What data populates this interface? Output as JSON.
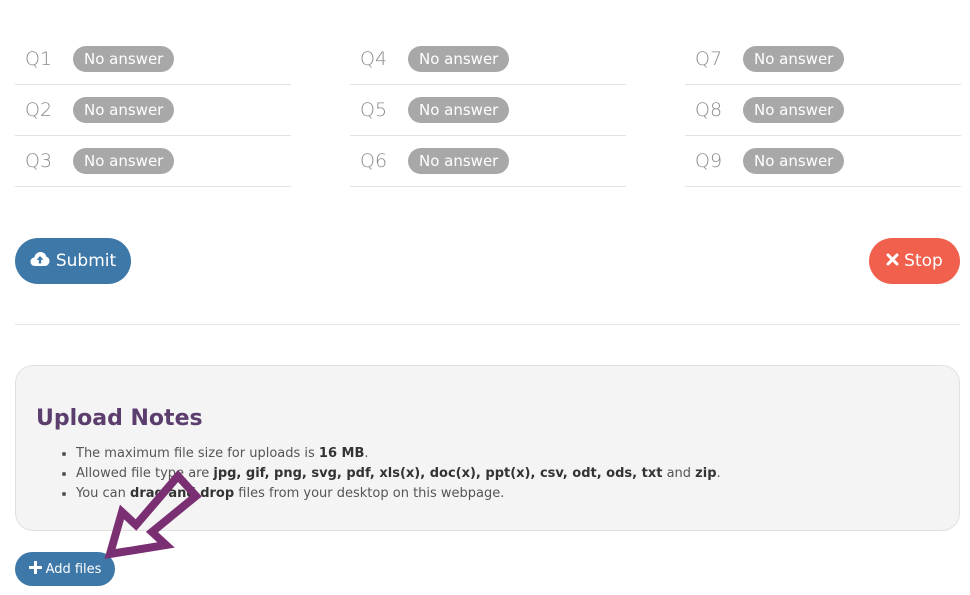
{
  "questions": {
    "col1": [
      {
        "label": "Q1",
        "status": "No answer"
      },
      {
        "label": "Q2",
        "status": "No answer"
      },
      {
        "label": "Q3",
        "status": "No answer"
      }
    ],
    "col2": [
      {
        "label": "Q4",
        "status": "No answer"
      },
      {
        "label": "Q5",
        "status": "No answer"
      },
      {
        "label": "Q6",
        "status": "No answer"
      }
    ],
    "col3": [
      {
        "label": "Q7",
        "status": "No answer"
      },
      {
        "label": "Q8",
        "status": "No answer"
      },
      {
        "label": "Q9",
        "status": "No answer"
      }
    ]
  },
  "actions": {
    "submit_label": "Submit",
    "stop_label": "Stop",
    "submit_color": "#3d78a8",
    "stop_color": "#f0604d"
  },
  "upload_notes": {
    "title": "Upload Notes",
    "note1_prefix": "The maximum file size for uploads is ",
    "note1_size": "16 MB",
    "note1_suffix": ".",
    "note2_prefix": "Allowed file type are ",
    "note2_types": "jpg, gif, png, svg, pdf, xls(x), doc(x), ppt(x), csv, odt, ods, txt",
    "note2_and": " and ",
    "note2_last": "zip",
    "note2_suffix": ".",
    "note3_prefix": "You can ",
    "note3_bold": "drag and drop",
    "note3_suffix": " files from your desktop on this webpage."
  },
  "add_files_label": "Add files",
  "icons": {
    "submit": "cloud-upload-icon",
    "stop": "close-icon",
    "add": "plus-icon",
    "annotation": "arrow-annotation"
  }
}
